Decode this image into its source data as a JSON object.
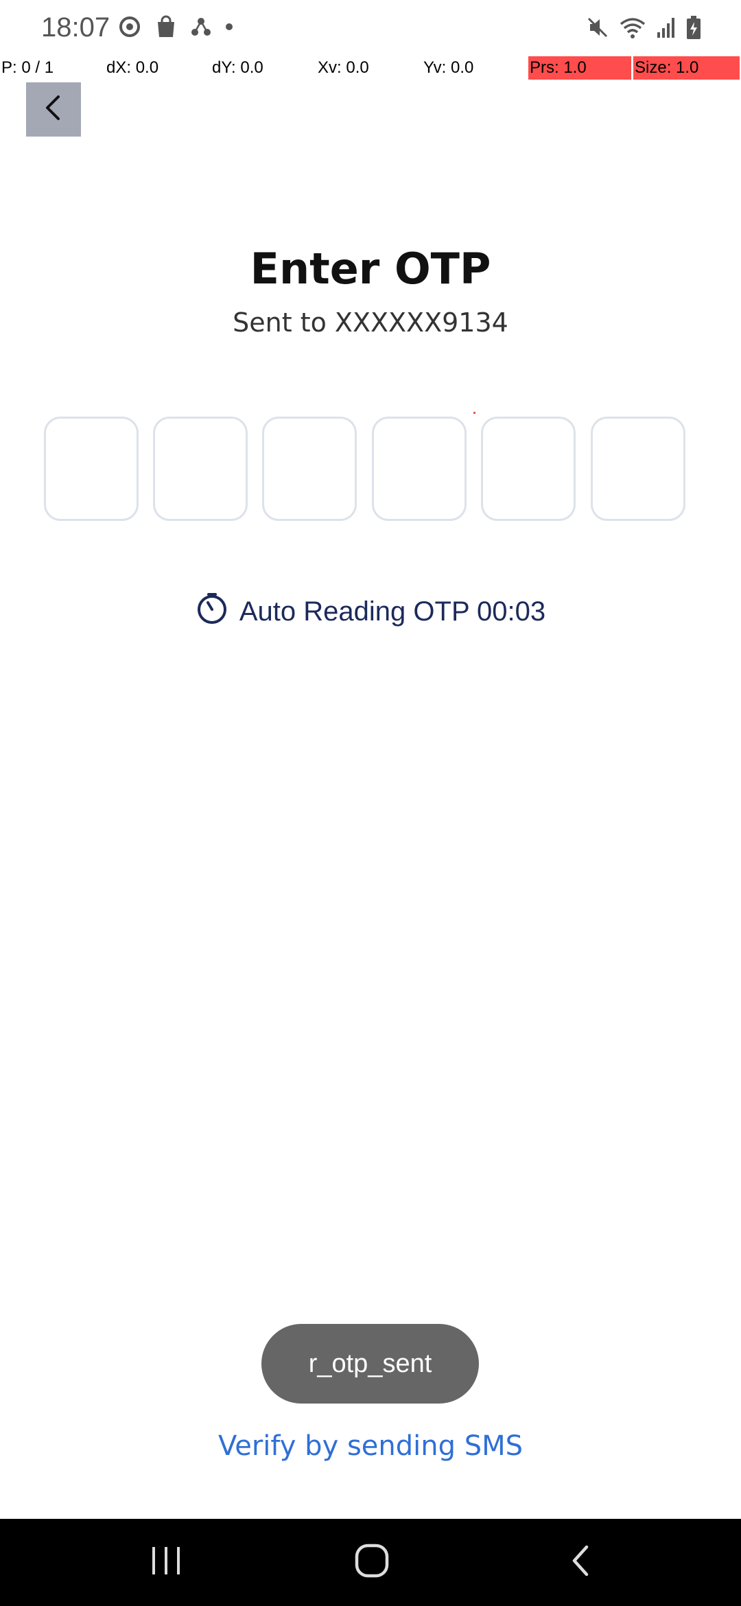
{
  "status_bar": {
    "time": "18:07",
    "left_icons": [
      "sync-icon",
      "shopping-bag-icon",
      "share-nodes-icon",
      "dot-icon"
    ],
    "right_icons": [
      "mute-icon",
      "wifi-icon",
      "signal-icon",
      "battery-charging-icon"
    ]
  },
  "pointer_info": {
    "p": "P: 0 / 1",
    "dx": "dX: 0.0",
    "dy": "dY: 0.0",
    "xv": "Xv: 0.0",
    "yv": "Yv: 0.0",
    "prs": "Prs: 1.0",
    "size": "Size: 1.0"
  },
  "header": {
    "back_icon": "chevron-left-icon"
  },
  "main": {
    "title": "Enter OTP",
    "subtitle": "Sent to XXXXXX9134",
    "otp_digits": [
      "",
      "",
      "",
      "",
      "",
      ""
    ],
    "auto_read_icon": "timer-icon",
    "auto_read_text": "Auto Reading OTP 00:03"
  },
  "toast": {
    "text": "r_otp_sent"
  },
  "footer": {
    "verify_link": "Verify by sending SMS"
  },
  "nav_bar": {
    "icons": [
      "recent-apps-icon",
      "home-icon",
      "back-icon"
    ]
  },
  "colors": {
    "accent_link": "#2f6fd6",
    "timer_text": "#1c2a5a",
    "highlight": "#ff4c4c",
    "otp_border": "#dde2ea"
  }
}
